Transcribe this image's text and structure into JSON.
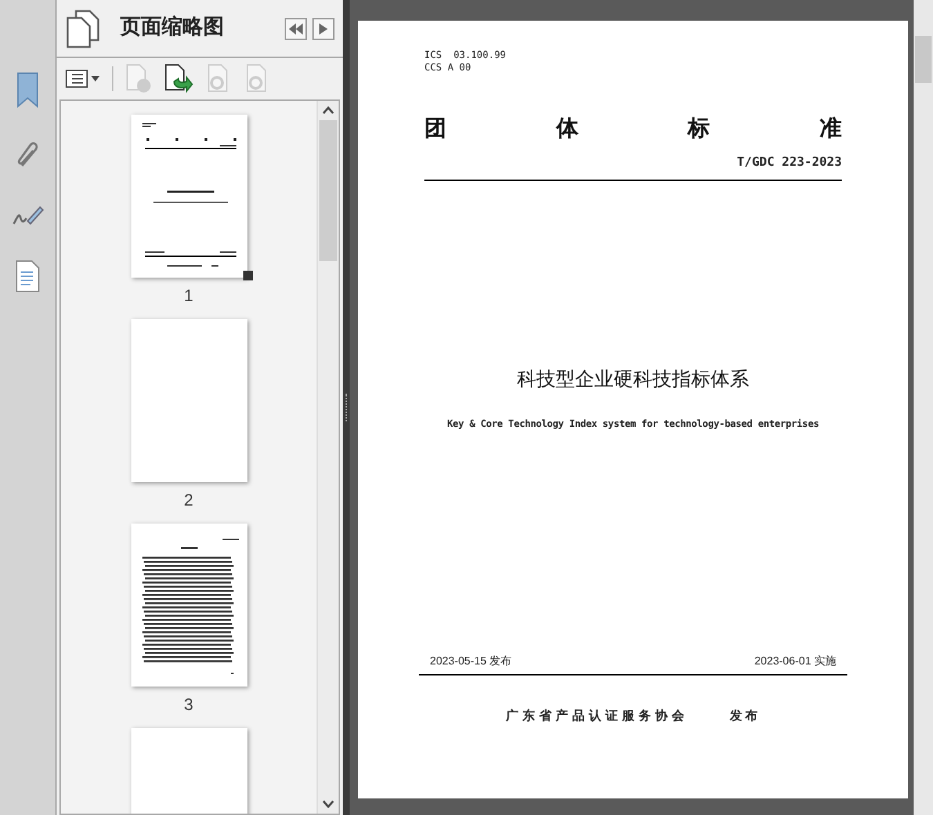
{
  "panel": {
    "title": "页面缩略图"
  },
  "toolbar": [
    {
      "kind": "options",
      "disabled": false
    },
    {
      "kind": "delete",
      "disabled": true
    },
    {
      "kind": "insert",
      "disabled": false
    },
    {
      "kind": "undo",
      "disabled": true
    },
    {
      "kind": "redo",
      "disabled": true
    }
  ],
  "thumbnails": [
    {
      "label": "1",
      "kind": "cover",
      "selected": true
    },
    {
      "label": "2",
      "kind": "blank",
      "selected": false
    },
    {
      "label": "3",
      "kind": "text",
      "selected": false
    },
    {
      "kind": "blank"
    }
  ],
  "document": {
    "codes": [
      "ICS  03.100.99",
      "CCS A 00"
    ],
    "heading": [
      "团",
      "体",
      "标",
      "准"
    ],
    "number": "T/GDC 223-2023",
    "title": "科技型企业硬科技指标体系",
    "subtitle": "Key & Core Technology Index system for technology-based enterprises",
    "issue_date": "2023-05-15 发布",
    "effective_date": "2023-06-01 实施",
    "publisher": "广东省产品认证服务协会",
    "publish_label": "发布"
  }
}
